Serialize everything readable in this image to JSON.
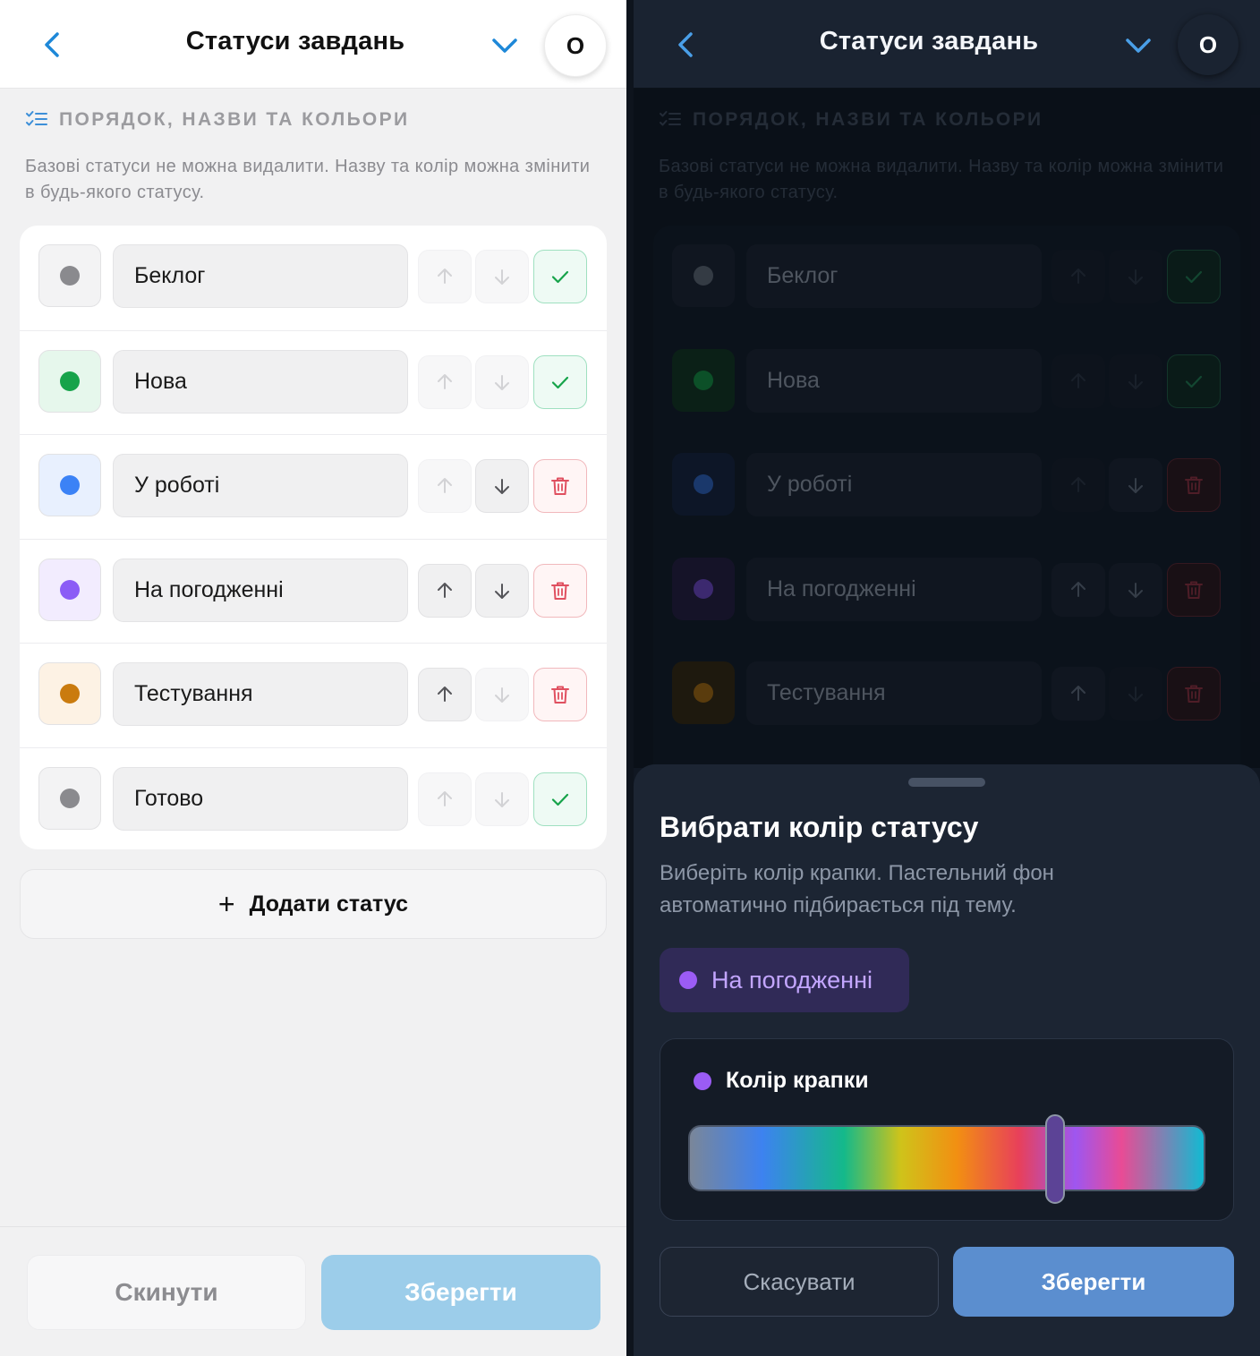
{
  "screen": {
    "title": "Статуси завдань",
    "avatar_initial": "О",
    "section_title": "ПОРЯДОК, НАЗВИ ТА КОЛЬОРИ",
    "section_description": "Базові статуси не можна видалити. Назву та колір можна змінити в будь-якого статусу.",
    "add_status_label": "Додати статус",
    "reset_label": "Скинути",
    "save_label": "Зберегти"
  },
  "statuses": [
    {
      "name": "Беклог",
      "dot": "#8a8a8e",
      "bg_light": "#f3f3f4",
      "bg_dark": "#1a2230",
      "dot_dark": "#5b6472",
      "can_up": false,
      "can_down": false,
      "action": "check"
    },
    {
      "name": "Нова",
      "dot": "#16a34a",
      "bg_light": "#e6f7ec",
      "bg_dark": "#12331f",
      "dot_dark": "#138a3e",
      "can_up": false,
      "can_down": false,
      "action": "check"
    },
    {
      "name": "У роботі",
      "dot": "#3b82f6",
      "bg_light": "#e8f0fe",
      "bg_dark": "#14223d",
      "dot_dark": "#2c5fb8",
      "can_up": false,
      "can_down": true,
      "action": "delete"
    },
    {
      "name": "На погодженні",
      "dot": "#8b5cf6",
      "bg_light": "#f2ecfe",
      "bg_dark": "#231d3f",
      "dot_dark": "#6a44c0",
      "can_up": true,
      "can_down": true,
      "action": "delete"
    },
    {
      "name": "Тестування",
      "dot": "#ca7b0e",
      "bg_light": "#fdf2e4",
      "bg_dark": "#33270f",
      "dot_dark": "#a0660d",
      "can_up": true,
      "can_down": false,
      "action": "delete"
    },
    {
      "name": "Готово",
      "dot": "#8a8a8e",
      "bg_light": "#f3f3f4",
      "bg_dark": "#1a2230",
      "dot_dark": "#5b6472",
      "can_up": false,
      "can_down": false,
      "action": "check"
    }
  ],
  "color_sheet": {
    "title": "Вибрати колір статусу",
    "description": "Виберіть колір крапки. Пастельний фон автоматично підбирається під тему.",
    "preview_name": "На погодженні",
    "preview_dot": "#9b5cf5",
    "picker_label": "Колір крапки",
    "slider_value": 0.71,
    "cancel_label": "Скасувати",
    "save_label": "Зберегти"
  },
  "colors": {
    "accent_light": "#1e88d8",
    "accent_dark": "#4a9fe8",
    "check_light": "#16a34a",
    "delete_light": "#e05060"
  }
}
